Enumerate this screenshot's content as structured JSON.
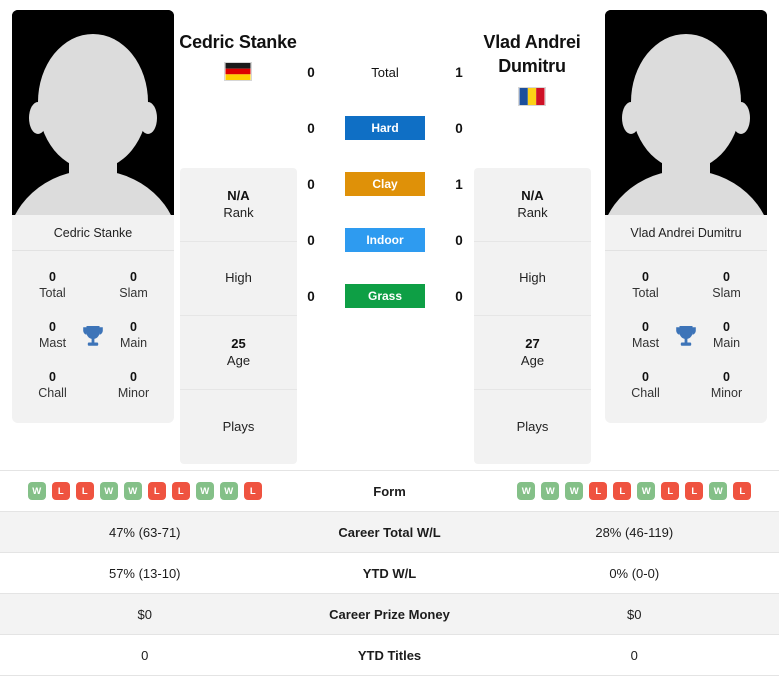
{
  "players": {
    "left": {
      "headline_name": "Cedric Stanke",
      "card_name": "Cedric Stanke",
      "flag": "germany-flag",
      "rank_value": "N/A",
      "rank_label": "Rank",
      "high_label": "High",
      "high_value": "",
      "age_value": "25",
      "age_label": "Age",
      "plays_label": "Plays",
      "plays_value": "",
      "titles": [
        {
          "value": "0",
          "label": "Total"
        },
        {
          "value": "0",
          "label": "Slam"
        },
        {
          "value": "0",
          "label": "Mast"
        },
        {
          "value": "0",
          "label": "Main"
        },
        {
          "value": "0",
          "label": "Chall"
        },
        {
          "value": "0",
          "label": "Minor"
        }
      ]
    },
    "right": {
      "headline_name": "Vlad Andrei Dumitru",
      "card_name": "Vlad Andrei Dumitru",
      "flag": "romania-flag",
      "rank_value": "N/A",
      "rank_label": "Rank",
      "high_label": "High",
      "high_value": "",
      "age_value": "27",
      "age_label": "Age",
      "plays_label": "Plays",
      "plays_value": "",
      "titles": [
        {
          "value": "0",
          "label": "Total"
        },
        {
          "value": "0",
          "label": "Slam"
        },
        {
          "value": "0",
          "label": "Mast"
        },
        {
          "value": "0",
          "label": "Main"
        },
        {
          "value": "0",
          "label": "Chall"
        },
        {
          "value": "0",
          "label": "Minor"
        }
      ]
    }
  },
  "h2h_surfaces": [
    {
      "label": "Total",
      "left": "0",
      "right": "1",
      "color": "",
      "style": "plain"
    },
    {
      "label": "Hard",
      "left": "0",
      "right": "0",
      "color": "#0f6fc5",
      "style": "badge"
    },
    {
      "label": "Clay",
      "left": "0",
      "right": "1",
      "color": "#df9108",
      "style": "badge"
    },
    {
      "label": "Indoor",
      "left": "0",
      "right": "0",
      "color": "#2e9bf0",
      "style": "badge"
    },
    {
      "label": "Grass",
      "left": "0",
      "right": "0",
      "color": "#0e9f45",
      "style": "badge"
    }
  ],
  "comparison": {
    "form": {
      "label": "Form",
      "left": [
        "W",
        "L",
        "L",
        "W",
        "W",
        "L",
        "L",
        "W",
        "W",
        "L"
      ],
      "right": [
        "W",
        "W",
        "W",
        "L",
        "L",
        "W",
        "L",
        "L",
        "W",
        "L"
      ]
    },
    "rows": [
      {
        "label": "Career Total W/L",
        "left": "47% (63-71)",
        "right": "28% (46-119)"
      },
      {
        "label": "YTD W/L",
        "left": "57% (13-10)",
        "right": "0% (0-0)"
      },
      {
        "label": "Career Prize Money",
        "left": "$0",
        "right": "$0"
      },
      {
        "label": "YTD Titles",
        "left": "0",
        "right": "0"
      }
    ]
  },
  "colors": {
    "win": "#84c088",
    "loss": "#ef5340",
    "card_bg": "#f2f2f2",
    "row_shaded": "#f3f3f3",
    "trophy": "#3d74b8"
  }
}
